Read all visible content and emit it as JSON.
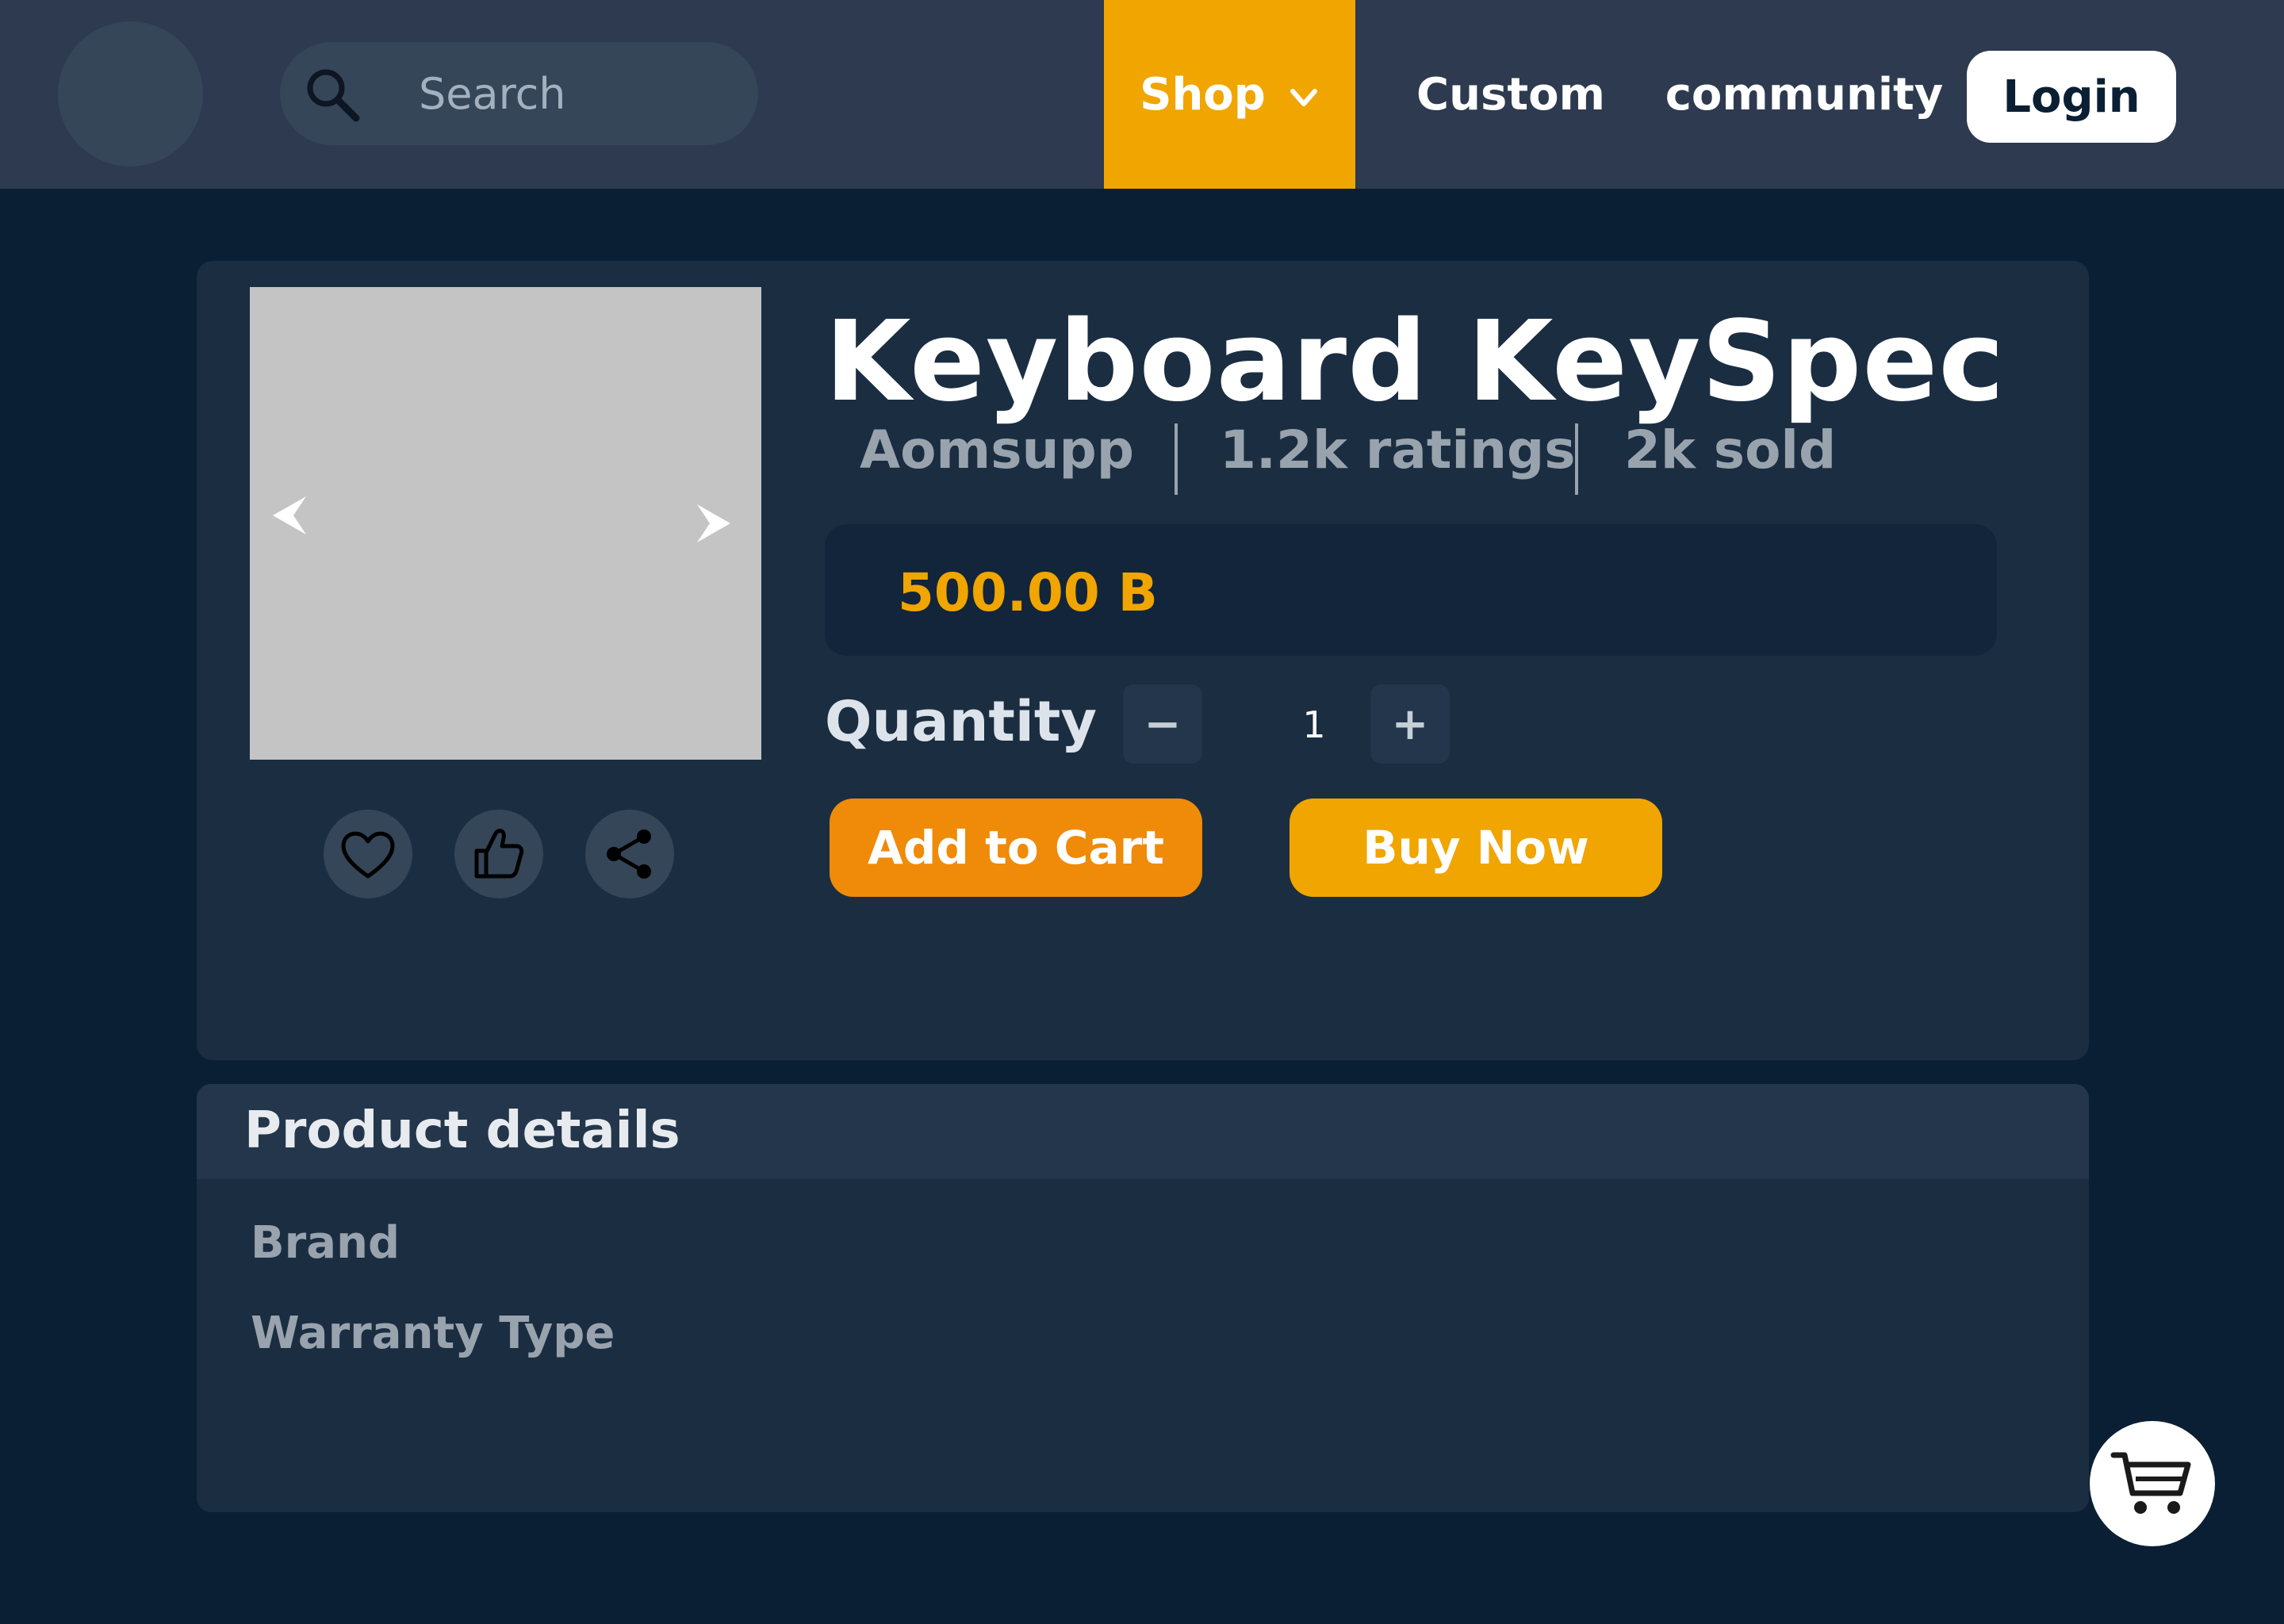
{
  "header": {
    "search": {
      "placeholder": "Search"
    },
    "nav": {
      "shop": "Shop",
      "custom": "Custom",
      "community": "community"
    },
    "login_label": "Login"
  },
  "product": {
    "title": "Keyboard KeySpec",
    "seller": "Aomsupp",
    "ratings": "1.2k ratings",
    "sold": "2k sold",
    "price": "500.00 B",
    "quantity_label": "Quantity",
    "quantity_value": "1",
    "decrement_label": "−",
    "increment_label": "+",
    "add_to_cart_label": "Add to Cart",
    "buy_now_label": "Buy Now"
  },
  "details": {
    "title": "Product details",
    "rows": [
      "Brand",
      "Warranty Type"
    ]
  },
  "icons": [
    "search-icon",
    "chevron-down-icon",
    "arrow-left-icon",
    "arrow-right-icon",
    "heart-icon",
    "thumbs-up-icon",
    "share-icon",
    "cart-icon"
  ],
  "colors": {
    "accent": "#f0a500",
    "cart_button": "#ef8b08",
    "page_bg": "#0a1f33",
    "topbar_bg": "#2d3a4f",
    "card_bg": "#1b2d41"
  }
}
